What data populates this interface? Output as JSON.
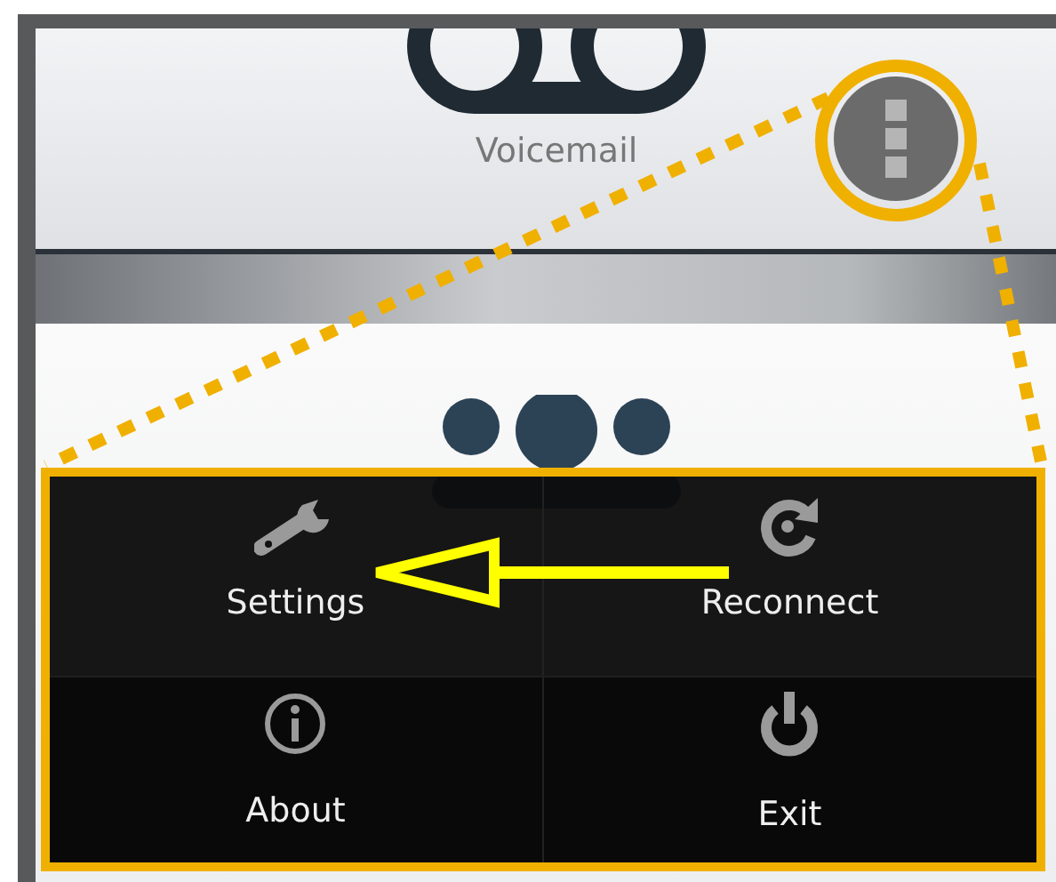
{
  "home": {
    "voicemail_label": "Voicemail"
  },
  "menu": {
    "items": [
      {
        "label": "Settings",
        "kind": "settings"
      },
      {
        "label": "Reconnect",
        "kind": "reconnect"
      },
      {
        "label": "About",
        "kind": "about"
      },
      {
        "label": "Exit",
        "kind": "exit"
      }
    ]
  }
}
